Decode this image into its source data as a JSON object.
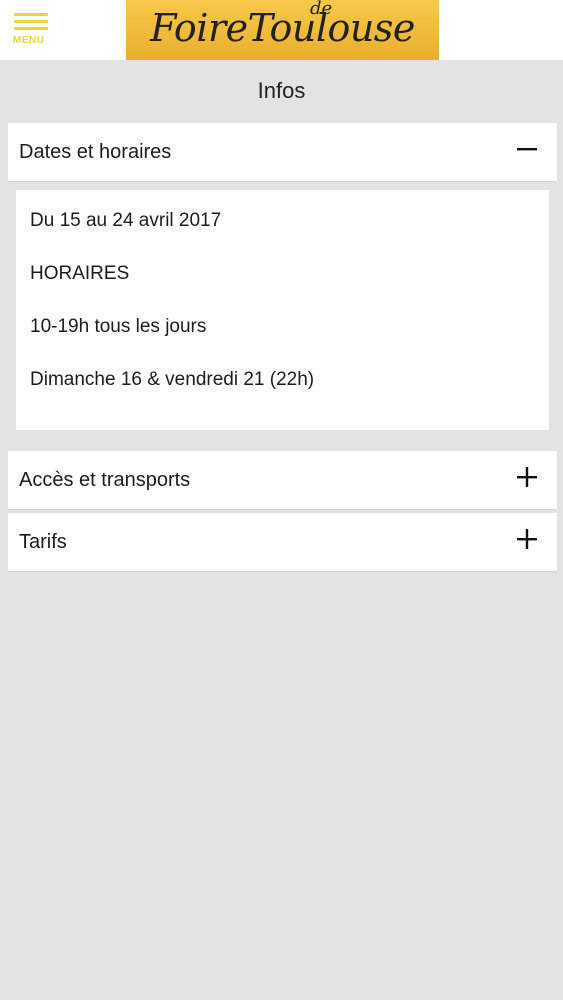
{
  "header": {
    "menu_label": "MENU",
    "logo_main": "FoireToulouse",
    "logo_de": "de",
    "brand_color": "#f2d33c"
  },
  "page": {
    "title": "Infos"
  },
  "accordion": [
    {
      "label": "Dates et horaires",
      "expanded": true,
      "toggle": "minus-icon",
      "lines": [
        "Du 15 au 24 avril 2017",
        "HORAIRES",
        "10-19h tous les jours",
        "Dimanche 16 & vendredi 21 (22h)"
      ]
    },
    {
      "label": "Accès et transports",
      "expanded": false,
      "toggle": "plus-icon"
    },
    {
      "label": "Tarifs",
      "expanded": false,
      "toggle": "plus-icon"
    }
  ]
}
